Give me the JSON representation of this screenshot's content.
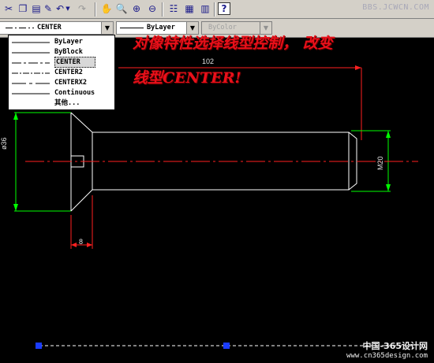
{
  "toolbar": {
    "icons": [
      "cut-icon",
      "copy-icon",
      "paste-icon",
      "match-properties-icon",
      "undo-icon",
      "redo-icon",
      "pan-icon",
      "zoom-realtime-icon",
      "zoom-window-icon",
      "zoom-previous-icon",
      "properties-icon",
      "design-center-icon",
      "tool-palettes-icon",
      "help-icon"
    ],
    "watermark": "BBS.JCWCN.COM"
  },
  "property_bar": {
    "linetype_value": "CENTER",
    "lineweight_value": "ByLayer",
    "plotstyle_value": "ByColor"
  },
  "linetype_dropdown": {
    "items": [
      "ByLayer",
      "ByBlock",
      "CENTER",
      "CENTER2",
      "CENTERX2",
      "Continuous",
      "其他..."
    ],
    "selected_index": 2
  },
  "annotation": {
    "line1": "对像特性选择线型控制， 改变",
    "line2": "线型CENTER!"
  },
  "dimensions": {
    "length": "102",
    "head_diameter": "ø36",
    "thread": "M20",
    "head_height": "8"
  },
  "footer": {
    "line1": "中国-365设计网",
    "line2": "www.cn365design.com"
  },
  "colors": {
    "annotation_red": "#e8101a",
    "dimension_green": "#00ff00",
    "dimension_red": "#ff2020",
    "grip_blue": "#1a3cff"
  }
}
